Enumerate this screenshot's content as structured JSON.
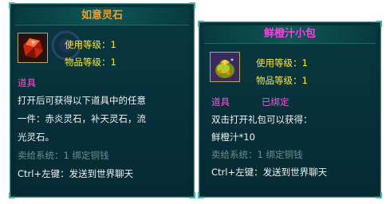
{
  "left_tooltip": {
    "title": "如意灵石",
    "icon": "red-gem-icon",
    "use_level": "使用等级：1",
    "item_level": "物品等级：1",
    "category": "道具",
    "description_lines": [
      "打开后可获得以下道具中的任意",
      "一件：赤炎灵石，补天灵石，流",
      "光灵石。"
    ],
    "sell_info": "卖给系统：1 绑定铜钱",
    "ctrl_hint": "Ctrl+左键：发送到世界聊天"
  },
  "right_tooltip": {
    "title": "鲜橙汁小包",
    "icon": "gift-bag-icon",
    "use_level": "使用等级：1",
    "item_level": "物品等级：1",
    "category": "道具",
    "bound_status": "已绑定",
    "description_lines": [
      "双击打开礼包可以获得：",
      "鲜橙汁*10"
    ],
    "sell_info": "卖给系统：1 绑定铜钱",
    "ctrl_hint": "Ctrl+左键：发送到世界聊天"
  },
  "colors": {
    "title_orange": "#ff9a1c",
    "title_magenta": "#ff40e6",
    "level_yellow": "#ffe83a",
    "category_pink": "#f05bd6",
    "panel_bg": "#07393e",
    "border_teal": "#2e8c8a"
  }
}
